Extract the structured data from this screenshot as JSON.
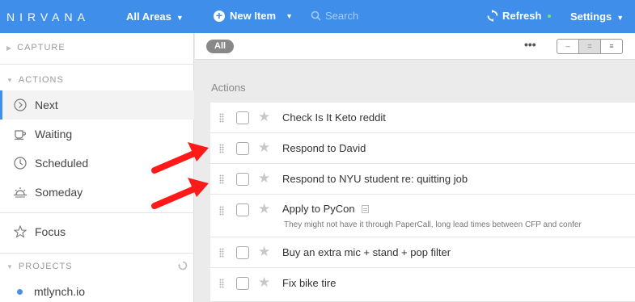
{
  "topbar": {
    "logo": "NIRVANA",
    "areas_label": "All Areas",
    "new_item_label": "New Item",
    "search_placeholder": "Search",
    "refresh_label": "Refresh",
    "settings_label": "Settings"
  },
  "sidebar": {
    "capture_header": "CAPTURE",
    "actions_header": "ACTIONS",
    "projects_header": "PROJECTS",
    "items": [
      {
        "label": "Next",
        "icon": "next-circle-icon"
      },
      {
        "label": "Waiting",
        "icon": "cup-icon"
      },
      {
        "label": "Scheduled",
        "icon": "clock-icon"
      },
      {
        "label": "Someday",
        "icon": "sunrise-icon"
      },
      {
        "label": "Focus",
        "icon": "star-outline-icon"
      }
    ],
    "projects": [
      {
        "label": "mtlynch.io"
      }
    ]
  },
  "filter": {
    "all_label": "All",
    "more_label": "•••",
    "view_options": [
      "–",
      "=",
      "≡"
    ]
  },
  "main": {
    "group_title": "Actions",
    "tasks": [
      {
        "title": "Check Is It Keto reddit",
        "note": ""
      },
      {
        "title": "Respond to David",
        "note": ""
      },
      {
        "title": "Respond to NYU student re: quitting job",
        "note": ""
      },
      {
        "title": "Apply to PyCon",
        "note": "They might not have it through PaperCall, long lead times between CFP and confer"
      },
      {
        "title": "Buy an extra mic + stand + pop filter",
        "note": ""
      },
      {
        "title": "Fix bike tire",
        "note": ""
      }
    ]
  },
  "colors": {
    "topbar": "#3f8ee9",
    "annotation_arrow": "#ff1a1a",
    "status_dot": "#7be35f"
  }
}
